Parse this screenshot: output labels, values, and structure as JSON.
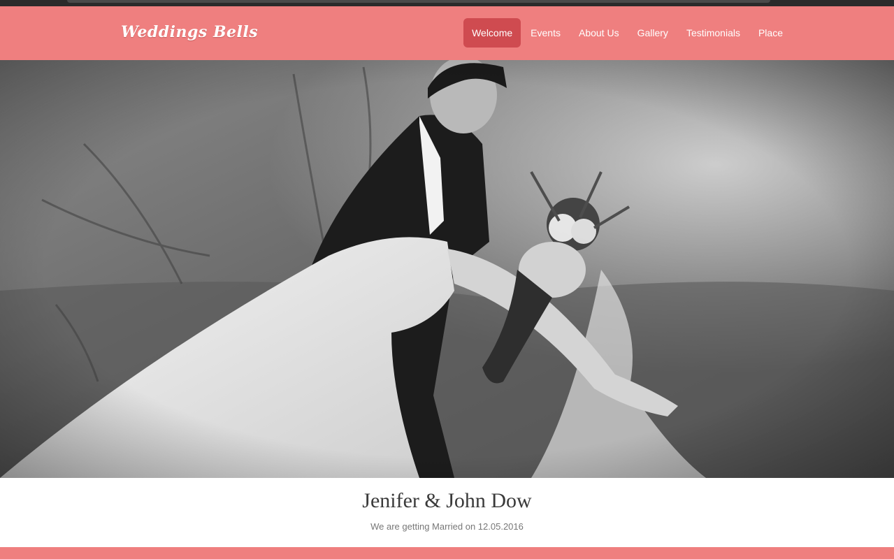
{
  "site": {
    "logo": "Weddings Bells"
  },
  "nav": {
    "items": [
      {
        "label": "Welcome",
        "active": true
      },
      {
        "label": "Events"
      },
      {
        "label": "About Us"
      },
      {
        "label": "Gallery"
      },
      {
        "label": "Testimonials"
      },
      {
        "label": "Place"
      }
    ]
  },
  "hero": {
    "image": "wedding-couple-photo",
    "style": "black-and-white"
  },
  "caption": {
    "names": "Jenifer & John Dow",
    "subtitle": "We are getting Married on 12.05.2016"
  },
  "colors": {
    "accent": "#ef7f7f",
    "active": "#cf4b50"
  }
}
